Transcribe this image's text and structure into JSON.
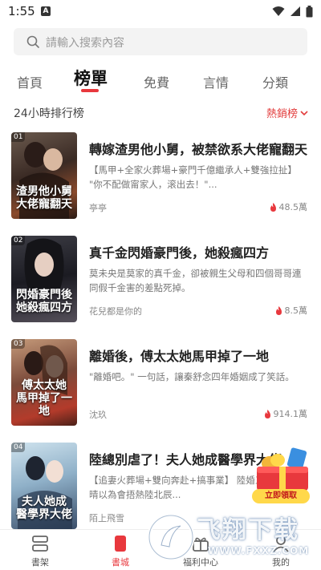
{
  "status": {
    "time": "1:55",
    "notif_icon": "A"
  },
  "search": {
    "placeholder": "請輸入搜索內容"
  },
  "tabs": [
    {
      "label": "首頁",
      "active": false
    },
    {
      "label": "榜單",
      "active": true
    },
    {
      "label": "免費",
      "active": false
    },
    {
      "label": "言情",
      "active": false
    },
    {
      "label": "分類",
      "active": false
    }
  ],
  "ranking": {
    "title": "24小時排行榜",
    "sort_label": "熱銷榜"
  },
  "books": [
    {
      "rank": "01",
      "cover_title": "渣男他小舅 大佬寵翻天",
      "title": "轉嫁渣男他小舅，被禁欲系大佬寵翻天",
      "desc": "【馬甲+全家火葬場+豪門千億繼承人+雙強拉扯】 \"你不配做甯家人，滚出去！\"...",
      "author": "亭亭",
      "heat": "48.5萬"
    },
    {
      "rank": "02",
      "cover_title": "閃婚豪門後 她殺瘋四方",
      "title": "真千金閃婚豪門後，她殺瘋四方",
      "desc": "莫未央是莫家的真千金，卻被親生父母和四個哥哥連同假千金害的差點死掉。",
      "author": "花兒都是你的",
      "heat": "8.5萬"
    },
    {
      "rank": "03",
      "cover_title": "傅太太她 馬甲掉了一地",
      "title": "離婚後，傅太太她馬甲掉了一地",
      "desc": "\"離婚吧。\" 一句話，讓秦舒念四年婚姻成了笑話。",
      "author": "沈玖",
      "heat": "914.1萬"
    },
    {
      "rank": "04",
      "cover_title": "夫人她成 醫學界大佬",
      "title": "陸總別虐了！夫人她成醫學界大佬",
      "desc": "【追妻火葬場+雙向奔赴+搞事業】 陸婚三年，何晴晴以為會捂熱陸北辰...",
      "author": "陌上飛雪",
      "heat": ""
    }
  ],
  "promo": {
    "button": "立即領取"
  },
  "nav": [
    {
      "label": "書架",
      "icon": "bookshelf-icon",
      "active": false
    },
    {
      "label": "書城",
      "icon": "bookstore-icon",
      "active": true
    },
    {
      "label": "福利中心",
      "icon": "gift-icon",
      "active": false
    },
    {
      "label": "我的",
      "icon": "profile-icon",
      "active": false
    }
  ],
  "watermark": {
    "text": "飞翔下载",
    "url": "WWW.FXXZ.COM"
  },
  "colors": {
    "accent": "#e8383d",
    "sort": "#e23b3b"
  }
}
